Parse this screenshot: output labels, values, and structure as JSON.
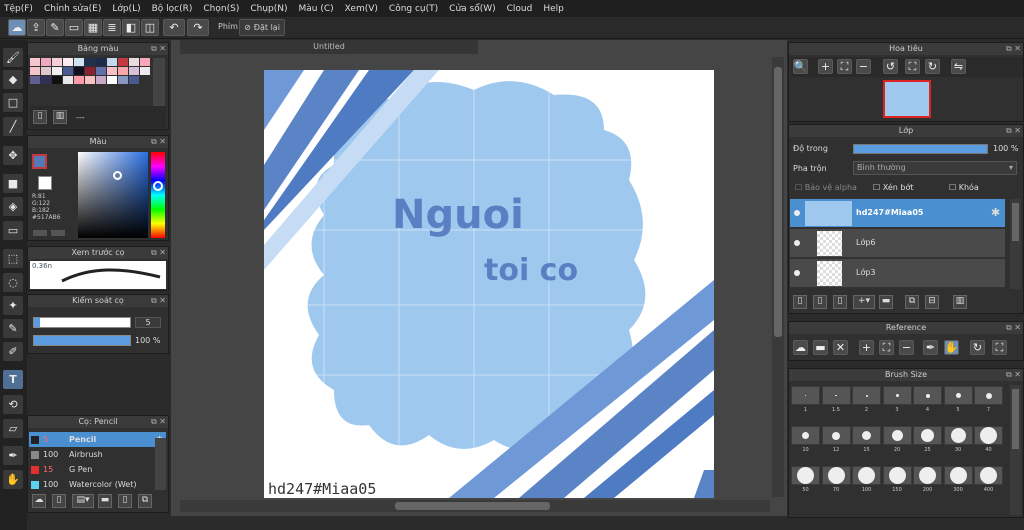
{
  "menu": [
    "Tệp(F)",
    "Chỉnh sửa(E)",
    "Lớp(L)",
    "Bộ lọc(R)",
    "Chọn(S)",
    "Chụp(N)",
    "Màu (C)",
    "Xem(V)",
    "Công cụ(T)",
    "Cửa sổ(W)",
    "Cloud",
    "Help"
  ],
  "toolbar": {
    "snap_label": "Phím",
    "reset_label": "Đặt lại"
  },
  "palette_panel": {
    "title": "Bảng màu",
    "label": "---"
  },
  "color_panel": {
    "title": "Màu",
    "r": "R:81",
    "g": "G:122",
    "b": "B:182",
    "hex": "#517AB6"
  },
  "preview_panel": {
    "title": "Xem trước cọ",
    "size": "0.36n"
  },
  "brush_ctrl": {
    "title": "Kiểm soát cọ",
    "size_value": "5",
    "opacity_value": "100 %"
  },
  "brush_list": {
    "title": "Cọ: Pencil",
    "items": [
      {
        "size": "5",
        "name": "Pencil"
      },
      {
        "size": "100",
        "name": "Airbrush"
      },
      {
        "size": "15",
        "name": "G Pen"
      },
      {
        "size": "100",
        "name": "Watercolor (Wet)"
      }
    ]
  },
  "canvas": {
    "tab_title": "Untitled",
    "text_line1": "Nguoi",
    "text_line2": "toi co",
    "signature": "hd247#Miaa05"
  },
  "navigator": {
    "title": "Hoa tiêu"
  },
  "layers": {
    "title": "Lớp",
    "opacity_label": "Độ trong",
    "opacity_value": "100 %",
    "blend_label": "Pha trộn",
    "blend_value": "Bình thường",
    "protect_alpha": "Bảo vệ alpha",
    "clip": "Xén bớt",
    "lock": "Khóa",
    "items": [
      {
        "name": "hd247#Miaa05"
      },
      {
        "name": "Lớp6"
      },
      {
        "name": "Lớp3"
      }
    ]
  },
  "reference": {
    "title": "Reference"
  },
  "brush_size": {
    "title": "Brush Size",
    "row1": [
      "1",
      "1.5",
      "2",
      "3",
      "4",
      "5",
      "7"
    ],
    "row2": [
      "10",
      "12",
      "15",
      "20",
      "25",
      "30",
      "40"
    ],
    "row3": [
      "50",
      "70",
      "100",
      "150",
      "200",
      "300",
      "400"
    ]
  },
  "colors": {
    "accent": "#517AB6",
    "selected": "#4a8fd0",
    "palette": [
      "#f5c6d0",
      "#f0a8c0",
      "#f5d0d8",
      "#fdeaf0",
      "#cfe3f5",
      "#203050",
      "#1d2a4a",
      "#c6d8f0",
      "#c23a40",
      "#e8dcdc",
      "#f8a8b8",
      "#f4c4c8",
      "#e0c8d0",
      "#f0f0f0",
      "#4a5a90",
      "#101020",
      "#8a2030",
      "#6070a8",
      "#f8c0c8",
      "#f8a8a8",
      "#d8c0d8",
      "#f0e8f0",
      "#606090",
      "#303058",
      "#101010",
      "#e8e8e8",
      "#fc9ca8",
      "#f8c0c0",
      "#c8a8c8",
      "#ffffff",
      "#8898c0",
      "#485890"
    ]
  }
}
